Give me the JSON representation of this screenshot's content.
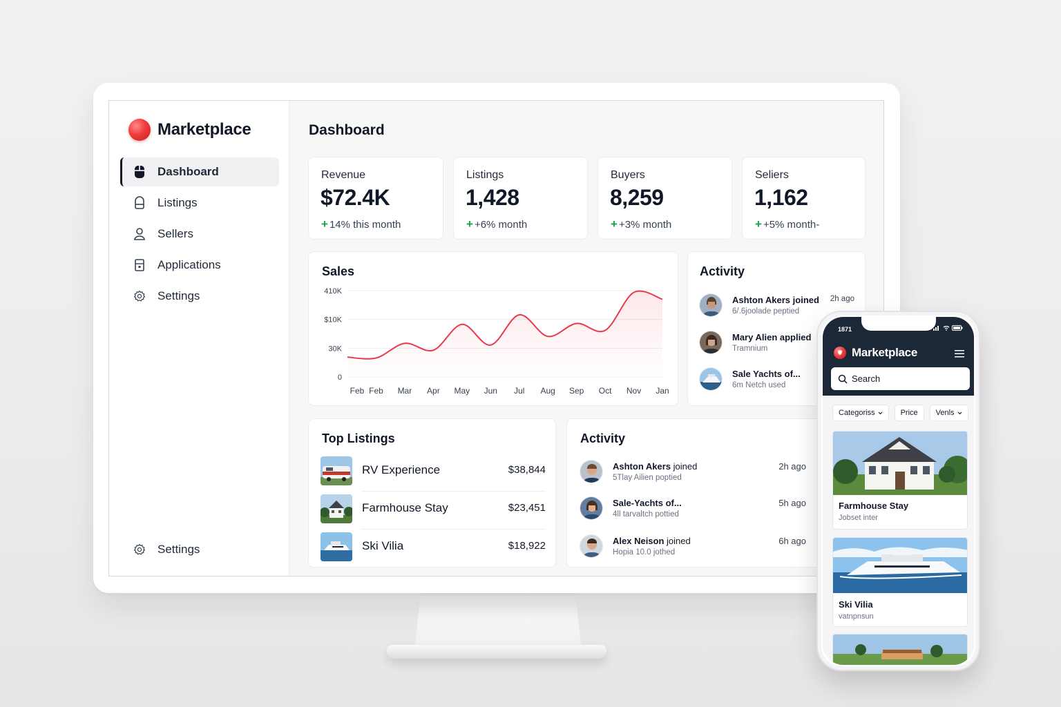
{
  "brand": {
    "name": "Marketplace",
    "color": "#ef3b3b"
  },
  "sidebar": {
    "items": [
      {
        "label": "Dashboard",
        "icon": "mouse-icon",
        "active": true
      },
      {
        "label": "Listings",
        "icon": "bag-icon"
      },
      {
        "label": "Sellers",
        "icon": "user-icon"
      },
      {
        "label": "Applications",
        "icon": "building-icon"
      },
      {
        "label": "Settings",
        "icon": "gear-icon"
      }
    ],
    "bottom": {
      "label": "Settings",
      "icon": "gear-icon"
    }
  },
  "main": {
    "title": "Dashboard",
    "stats": [
      {
        "label": "Revenue",
        "value": "$72.4K",
        "delta_sign": "+",
        "delta": "14% this month"
      },
      {
        "label": "Listings",
        "value": "1,428",
        "delta_sign": "+",
        "delta": "+6% month"
      },
      {
        "label": "Buyers",
        "value": "8,259",
        "delta_sign": "+",
        "delta": "+3% month"
      },
      {
        "label": "Seliers",
        "value": "1,162",
        "delta_sign": "+",
        "delta": "+5% month-"
      }
    ],
    "positive_color": "#16a34a",
    "sales": {
      "title": "Sales",
      "line_color": "#e8394a"
    },
    "activity_small": {
      "title": "Activity",
      "items": [
        {
          "name": "Ashton Akers joined",
          "sub": "6/.6joolade peptied",
          "time": "2h ago"
        },
        {
          "name": "Mary Alien applied",
          "sub": "Tramnium",
          "time": ""
        },
        {
          "name": "Sale Yachts of...",
          "sub": "6m Netch used",
          "time": ""
        }
      ]
    },
    "top_listings": {
      "title": "Top Listings",
      "items": [
        {
          "name": "RV Experience",
          "price": "$38,844",
          "image": "rv-photo"
        },
        {
          "name": "Farmhouse Stay",
          "price": "$23,451",
          "image": "farmhouse-photo"
        },
        {
          "name": "Ski Vilia",
          "price": "$18,922",
          "image": "yacht-photo"
        }
      ]
    },
    "activity_large": {
      "title": "Activity",
      "items": [
        {
          "name": "Ashton Akers",
          "verb": "joined",
          "sub": "5Tlay Ailien poptied",
          "time": "2h ago"
        },
        {
          "name": "Sale-Yachts of...",
          "verb": "",
          "sub": "4ll tarvaltch pottied",
          "time": "5h ago"
        },
        {
          "name": "Alex Neison",
          "verb": "joined",
          "sub": "Hopia 10.0 jothed",
          "time": "6h ago"
        }
      ]
    }
  },
  "phone": {
    "status_time": "1871",
    "brand": "Marketplace",
    "search_placeholder": "Search",
    "filters": [
      {
        "label": "Categoriss",
        "dropdown": true
      },
      {
        "label": "Price",
        "dropdown": false
      },
      {
        "label": "Venls",
        "dropdown": true
      }
    ],
    "cards": [
      {
        "title": "Farmhouse Stay",
        "sub": "Jobset inter",
        "image": "farmhouse-photo"
      },
      {
        "title": "Ski Vilia",
        "sub": "vatnpnsun",
        "image": "yacht-photo"
      },
      {
        "title": "",
        "sub": "",
        "image": "ranch-photo"
      }
    ]
  },
  "chart_data": {
    "type": "line",
    "title": "Sales",
    "x": [
      "Feb",
      "Feb",
      "Mar",
      "Apr",
      "May",
      "Jun",
      "Jul",
      "Aug",
      "Sep",
      "Oct",
      "Nov",
      "Jan"
    ],
    "y_tick_labels": [
      "0",
      "30K",
      "$10K",
      "410K"
    ],
    "series": [
      {
        "values": [
          0.23,
          0.22,
          0.39,
          0.31,
          0.61,
          0.37,
          0.72,
          0.47,
          0.62,
          0.54,
          0.98,
          0.9
        ]
      }
    ],
    "ylim": [
      0,
      1
    ],
    "grid": true,
    "legend": "none"
  }
}
